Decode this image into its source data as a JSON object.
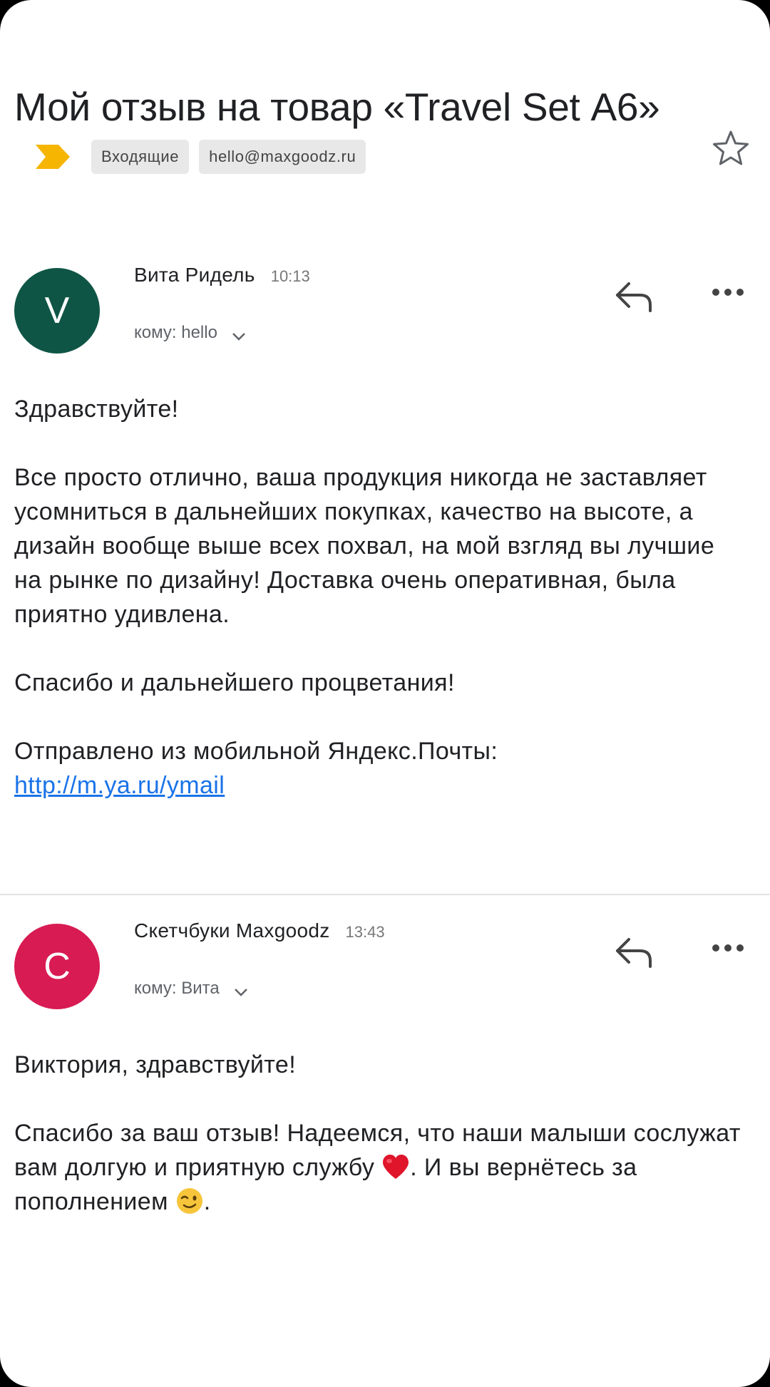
{
  "subject": {
    "title": "Мой отзыв на товар «Travel Set А6»",
    "labels": [
      "Входящие",
      "hello@maxgoodz.ru"
    ]
  },
  "colors": {
    "importance": "#f6b500",
    "avatar_v": "#0f5545",
    "avatar_c": "#d81b53",
    "link": "#1a73e8"
  },
  "messages": [
    {
      "avatar_letter": "V",
      "sender": "Вита Ридель",
      "time": "10:13",
      "recipient": "кому: hello",
      "greeting": "Здравствуйте!",
      "paragraph": "Все просто отлично, ваша продукция никогда не заставляет усомниться в дальнейших покупках, качество на высоте, а дизайн вообще выше всех похвал, на мой взгляд вы лучшие на рынке по дизайну! Доставка очень оперативная, была приятно удивлена.",
      "closing": "Спасибо и дальнейшего процветания!",
      "signature": "Отправлено из мобильной Яндекс.Почты:",
      "link": "http://m.ya.ru/ymail"
    },
    {
      "avatar_letter": "С",
      "sender": "Скетчбуки Maxgoodz",
      "time": "13:43",
      "recipient": "кому: Вита",
      "greeting": "Виктория, здравствуйте!",
      "paragraph_part1": "Спасибо за ваш отзыв! Надеемся, что наши малыши сослужат вам долгую и приятную службу",
      "paragraph_part2": ". И вы вернётесь за пополнением",
      "paragraph_part3": "."
    }
  ],
  "icons": {
    "importance": "importance-marker-icon",
    "star": "star-outline-icon",
    "reply": "reply-arrow-icon",
    "more": "more-dots-icon",
    "expand": "chevron-down-icon",
    "heart": "red-heart-emoji",
    "wink": "winking-face-emoji"
  }
}
